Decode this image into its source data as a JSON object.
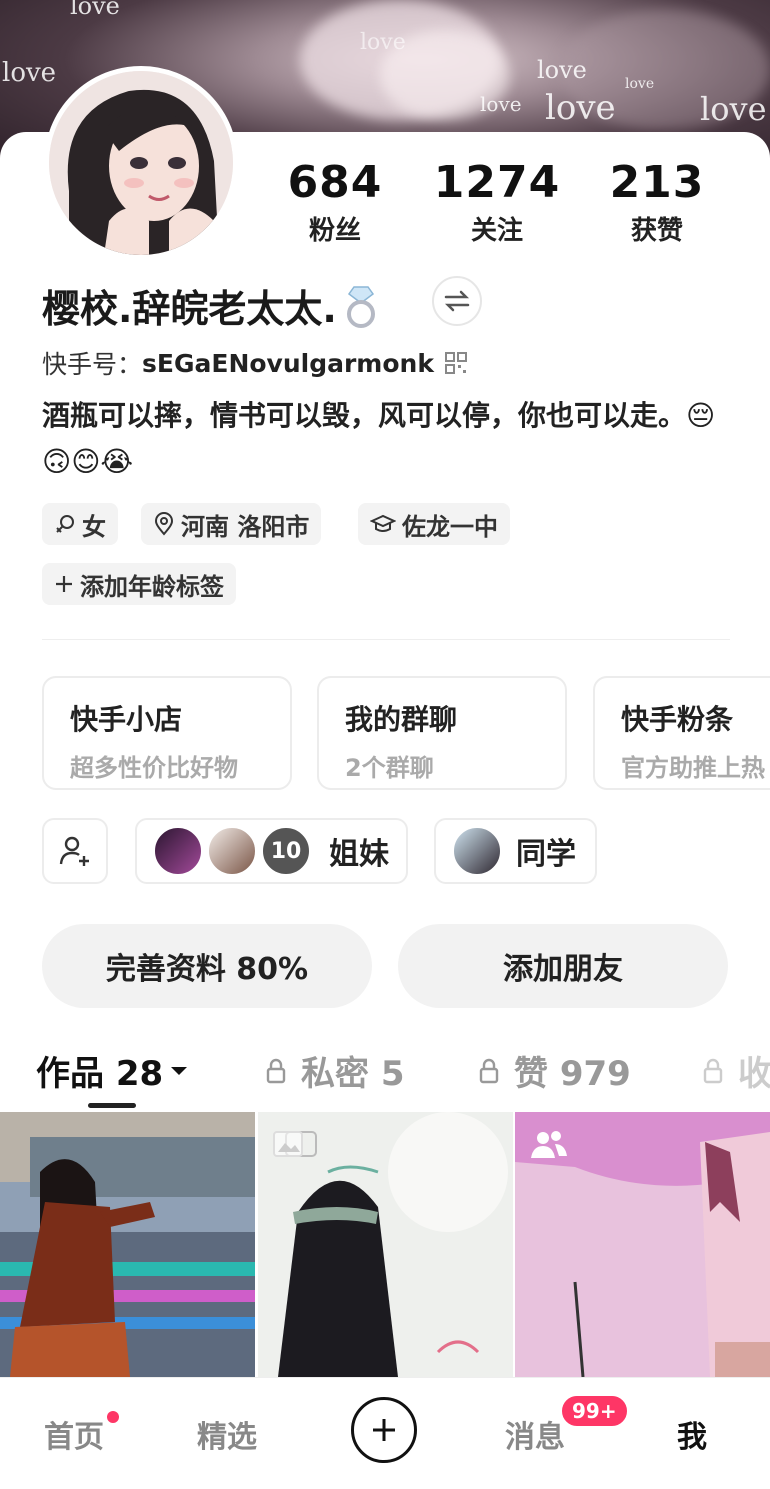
{
  "banner": {
    "love_words": [
      "love",
      "love",
      "love",
      "love",
      "love",
      "love",
      "love",
      "love"
    ]
  },
  "stats": [
    {
      "value": "684",
      "label": "粉丝"
    },
    {
      "value": "1274",
      "label": "关注"
    },
    {
      "value": "213",
      "label": "获赞"
    }
  ],
  "profile": {
    "nickname": "樱校.辞皖老太太.",
    "kid_label": "快手号：",
    "kid_value": "sEGaENovulgarmonk",
    "bio": "酒瓶可以摔，情书可以毁，风可以停，你也可以走。😔🙃😊😭"
  },
  "tags": [
    {
      "label": "女",
      "icon": "female-icon"
    },
    {
      "label": "河南 洛阳市",
      "icon": "location-pin-icon"
    },
    {
      "label": "佐龙一中",
      "icon": "school-cap-icon"
    },
    {
      "label": "添加年龄标签",
      "icon": "plus-icon"
    }
  ],
  "feature_cards": [
    {
      "title": "快手小店",
      "subtitle": "超多性价比好物"
    },
    {
      "title": "我的群聊",
      "subtitle": "2个群聊"
    },
    {
      "title": "快手粉条",
      "subtitle": "官方助推上热"
    }
  ],
  "groups": [
    {
      "label": "姐妹",
      "count": "10"
    },
    {
      "label": "同学"
    }
  ],
  "buttons": {
    "complete_profile": "完善资料 80%",
    "add_friend": "添加朋友"
  },
  "tabs": [
    {
      "label": "作品 28"
    },
    {
      "label": "私密 5"
    },
    {
      "label": "赞 979"
    },
    {
      "label": "收"
    }
  ],
  "bottom_nav": [
    {
      "label": "首页"
    },
    {
      "label": "精选"
    },
    {
      "label": "消息",
      "badge": "99+"
    },
    {
      "label": "我"
    }
  ],
  "colors": {
    "accent": "#fe3666",
    "text": "#222222",
    "muted": "#999999"
  }
}
